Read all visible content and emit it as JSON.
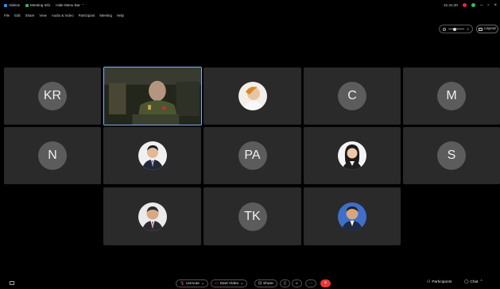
{
  "titlebar": {
    "videos_label": "Videos",
    "meeting_info_label": "Meeting Info",
    "view_label": "Hide Menu Bar",
    "clock": "21:41:20"
  },
  "menubar": [
    "File",
    "Edit",
    "Share",
    "View",
    "Audio & Video",
    "Participant",
    "Meeting",
    "Help"
  ],
  "view_controls": {
    "layout_label": "Layout"
  },
  "tiles": [
    {
      "initials": "KR"
    },
    {
      "initials": ""
    },
    {
      "initials": ""
    },
    {
      "initials": "C"
    },
    {
      "initials": "M"
    },
    {
      "initials": "N"
    },
    {
      "initials": ""
    },
    {
      "initials": "PA"
    },
    {
      "initials": ""
    },
    {
      "initials": "S"
    },
    {
      "initials": ""
    },
    {
      "initials": "TK"
    },
    {
      "initials": ""
    }
  ],
  "toolbar": {
    "unmute_label": "Unmute",
    "start_video_label": "Start Video",
    "share_label": "Share",
    "participants_label": "Participants",
    "chat_label": "Chat"
  },
  "colors": {
    "background": "#000000",
    "tile": "#2a2a2a",
    "initials_circle": "#5c5c5c",
    "active_border": "#7fb2ff",
    "end_button": "#e53935",
    "muted_icon": "#ff5a5a"
  }
}
